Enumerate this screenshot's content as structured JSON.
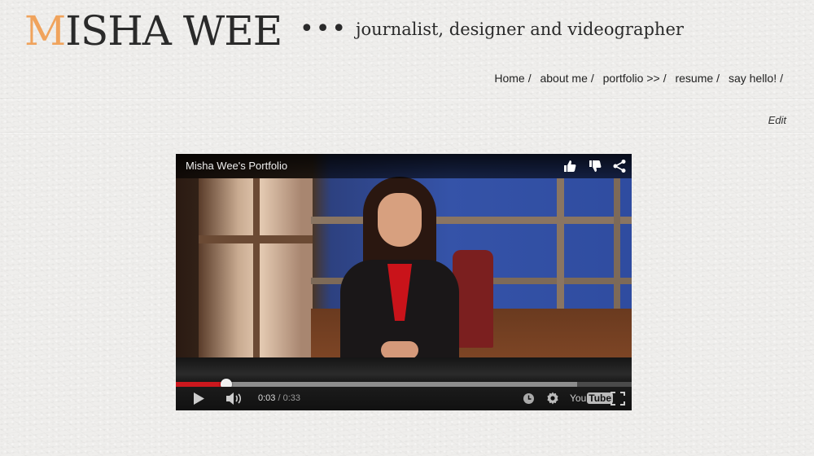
{
  "header": {
    "logo_initial": "M",
    "logo_rest": "ISHA WEE",
    "separator": "•••",
    "tagline": "journalist, designer and videographer"
  },
  "nav": {
    "separator": "/",
    "items": [
      {
        "label": "Home"
      },
      {
        "label": "about me"
      },
      {
        "label": "portfolio >>"
      },
      {
        "label": "resume"
      },
      {
        "label": "say hello!"
      }
    ]
  },
  "edit_label": "Edit",
  "video": {
    "title": "Misha Wee's Portfolio",
    "current_time": "0:03",
    "time_separator": " / ",
    "duration": "0:33",
    "played_fraction": 0.111,
    "buffered_fraction": 0.88,
    "icons": [
      "thumbs-up-icon",
      "thumbs-down-icon",
      "share-icon",
      "play-icon",
      "volume-icon",
      "watch-later-icon",
      "gear-icon",
      "youtube-logo",
      "fullscreen-icon"
    ],
    "brand_you": "You",
    "brand_tube": "Tube"
  },
  "colors": {
    "accent": "#f0a35c",
    "text": "#2a2a2a",
    "progress_played": "#cc181e"
  }
}
